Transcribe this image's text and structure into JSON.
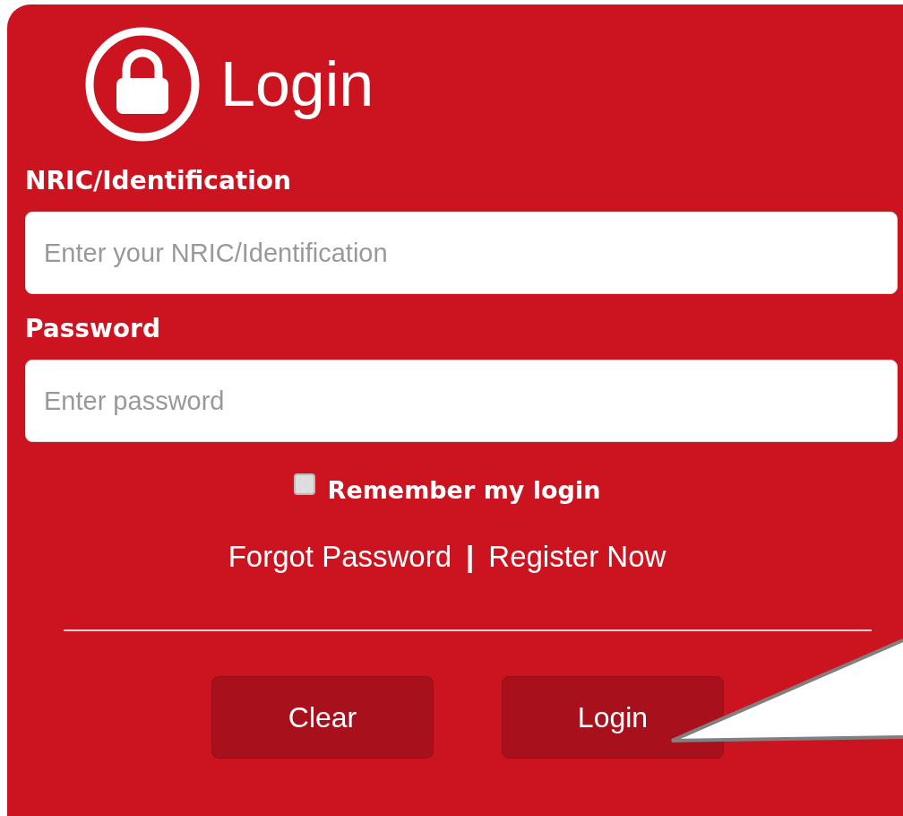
{
  "title": "Login",
  "id_field": {
    "label": "NRIC/Identification",
    "placeholder": "Enter your NRIC/Identification"
  },
  "password_field": {
    "label": "Password",
    "placeholder": "Enter password"
  },
  "remember": {
    "label": "Remember my login",
    "checked": false
  },
  "links": [
    {
      "label": "Forgot Password"
    },
    {
      "label": "Register Now"
    }
  ],
  "link_separator": "|",
  "buttons": [
    {
      "label": "Clear"
    },
    {
      "label": "Login"
    }
  ]
}
